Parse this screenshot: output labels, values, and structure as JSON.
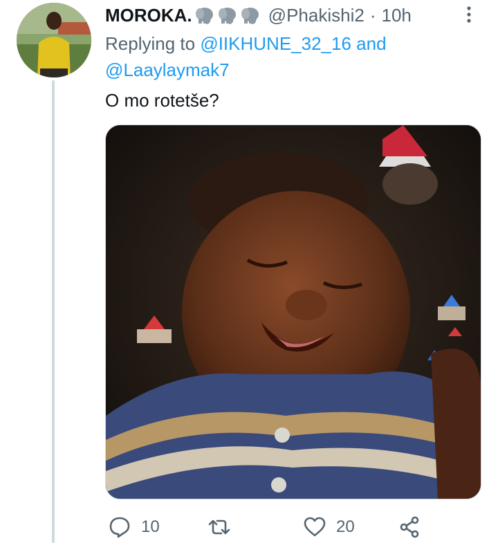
{
  "tweet": {
    "display_name": "MOROKA.",
    "name_emojis": [
      "elephant-emoji",
      "elephant-emoji",
      "elephant-emoji"
    ],
    "handle": "@Phakishi2",
    "separator": "·",
    "time": "10h",
    "replying_prefix": "Replying to",
    "reply_mentions": [
      "@IIKHUNE_32_16",
      "@Laaylaymak7"
    ],
    "reply_conjunction": "and",
    "text": "O mo rotetše?",
    "media_description": "photo",
    "colors": {
      "text": "#0f1419",
      "secondary": "#536471",
      "link": "#1d9bf0",
      "thread_line": "#cfd9de"
    }
  },
  "actions": {
    "reply": {
      "icon": "reply-icon",
      "count": "10"
    },
    "retweet": {
      "icon": "retweet-icon",
      "count": ""
    },
    "like": {
      "icon": "heart-icon",
      "count": "20"
    },
    "share": {
      "icon": "share-icon",
      "count": ""
    }
  },
  "more_icon": "more-icon"
}
